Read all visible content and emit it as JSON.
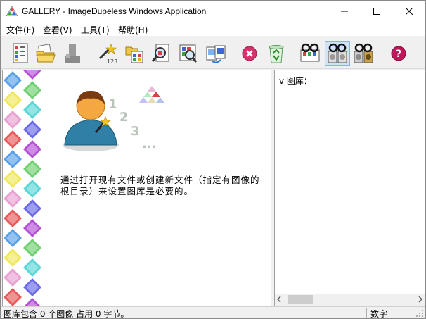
{
  "window": {
    "title": "GALLERY - ImageDupeless Windows Application",
    "min_icon": "minimize-icon",
    "max_icon": "maximize-icon",
    "close_icon": "close-icon"
  },
  "menu": [
    {
      "label": "文件(F)"
    },
    {
      "label": "查看(V)"
    },
    {
      "label": "工具(T)"
    },
    {
      "label": "帮助(H)"
    }
  ],
  "toolbar": [
    {
      "icon": "gallery-list-icon"
    },
    {
      "icon": "open-folder-icon"
    },
    {
      "icon": "disabled-user-icon"
    },
    {
      "icon": "numbering-wand-icon"
    },
    {
      "icon": "folder-tree-icon"
    },
    {
      "icon": "search-doc-icon"
    },
    {
      "icon": "search-images-icon"
    },
    {
      "icon": "compare-images-icon"
    },
    {
      "icon": "stop-icon"
    },
    {
      "icon": "recycle-icon"
    },
    {
      "icon": "view-glasses-1-icon"
    },
    {
      "icon": "view-glasses-2-icon"
    },
    {
      "icon": "view-glasses-3-icon"
    },
    {
      "icon": "help-icon"
    }
  ],
  "welcome": {
    "text": "通过打开现有文件或创建新文件（指定有图像的根目录）来设置图库是必要的。",
    "step_numbers": [
      "1",
      "2",
      "3",
      "..."
    ]
  },
  "right_pane": {
    "label": "v 图库："
  },
  "status": {
    "text": "图库包含 0 个图像 占用 0 字节。",
    "indicator": "数字"
  },
  "colors": {
    "selection": "#cfe3f5",
    "stop_red": "#d6336c",
    "help_purple": "#c2185b"
  }
}
